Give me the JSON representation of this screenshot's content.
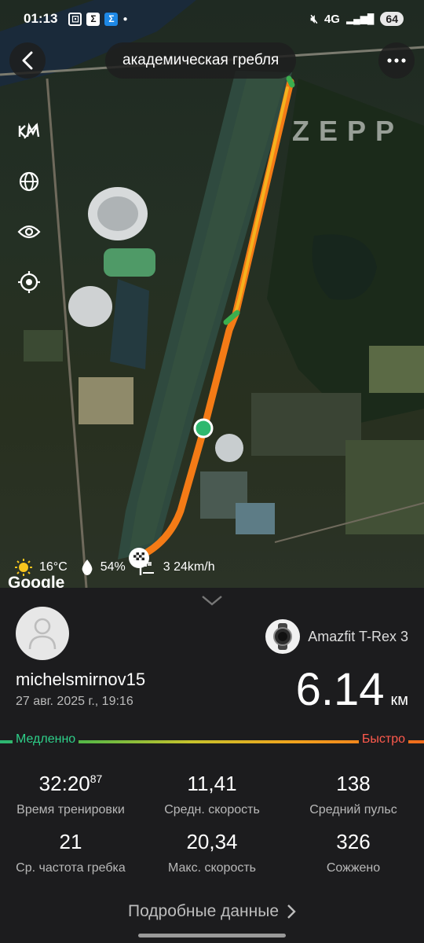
{
  "status_bar": {
    "time": "01:13",
    "network": "4G",
    "battery": "64",
    "icons": [
      "camera-icon",
      "sigma-app-icon",
      "sigma-app-icon-2",
      "dot-icon",
      "mute-icon",
      "signal-icon"
    ]
  },
  "header": {
    "title": "академическая гребля",
    "back_icon": "back-arrow-icon",
    "more_icon": "more-icon"
  },
  "map": {
    "watermark": "ZEPP",
    "attribution": "Google",
    "tools": [
      "map-type-icon",
      "globe-icon",
      "eye-icon",
      "locate-icon"
    ],
    "weather": {
      "temperature": "16°C",
      "humidity": "54%",
      "wind": "3 24km/h"
    }
  },
  "profile": {
    "username": "michelsmirnov15",
    "date": "27 авг. 2025 г., 19:16",
    "device": "Amazfit T-Rex 3"
  },
  "summary": {
    "distance": "6.14",
    "distance_unit": "км",
    "slow_label": "Медленно",
    "fast_label": "Быстро"
  },
  "stats": [
    {
      "value": "32:20",
      "sup": "87",
      "label": "Время тренировки"
    },
    {
      "value": "11,41",
      "sup": "",
      "label": "Средн. скорость"
    },
    {
      "value": "138",
      "sup": "",
      "label": "Средний пульс"
    },
    {
      "value": "21",
      "sup": "",
      "label": "Ср. частота гребка"
    },
    {
      "value": "20,34",
      "sup": "",
      "label": "Макс. скорость"
    },
    {
      "value": "326",
      "sup": "",
      "label": "Сожжено"
    }
  ],
  "details_link": "Подробные данные",
  "colors": {
    "slow": "#2ed08a",
    "fast": "#ff5a4d",
    "track_orange": "#f47b16",
    "track_yellow": "#f5b21f",
    "track_green": "#3cae4e"
  }
}
